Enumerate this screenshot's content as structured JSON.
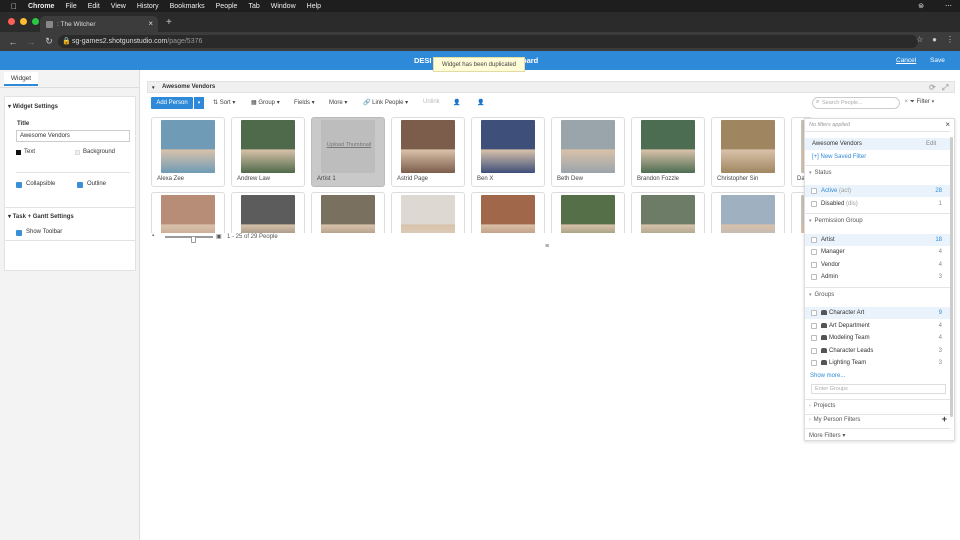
{
  "macmenu": {
    "apple": "",
    "app": "Chrome",
    "items": [
      "File",
      "Edit",
      "View",
      "History",
      "Bookmarks",
      "People",
      "Tab",
      "Window",
      "Help"
    ]
  },
  "browser": {
    "tab_title": ": The Witcher",
    "url_host": "sg-games2.shotgunstudio.com",
    "url_path": "/page/5376"
  },
  "header": {
    "title_left": "DESI",
    "title_right": "oard",
    "cancel": "Cancel",
    "save": "Save"
  },
  "toast": "Widget has been duplicated",
  "left_panel": {
    "tab": "Widget",
    "widget_settings": "Widget Settings",
    "title_label": "Title",
    "title_value": "Awesome Vendors",
    "text_label": "Text",
    "background_label": "Background",
    "collapsible": "Collapsible",
    "outline": "Outline",
    "task_gantt": "Task + Gantt Settings",
    "show_toolbar": "Show Toolbar"
  },
  "widget": {
    "title": "Awesome Vendors",
    "toolbar": {
      "add_person": "Add Person",
      "sort": "Sort",
      "group": "Group",
      "fields": "Fields",
      "more": "More",
      "link_people": "Link People",
      "unlink": "Unlink",
      "search_placeholder": "Search People...",
      "filter": "Filter"
    },
    "people_row1": [
      "Alexa Zee",
      "Andrew Law",
      "Artist 1",
      "Astrid Page",
      "Ben X",
      "Beth Dew",
      "Brandon Fozzle",
      "Christopher Sin",
      "Da"
    ],
    "upload_thumb": "Upload Thumbnail",
    "pager": "1 - 25 of 29 People"
  },
  "filter_panel": {
    "none": "No filters applied",
    "saved": "Awesome Vendors",
    "edit": "Edit",
    "new_saved": "[+] New Saved Filter",
    "status": "Status",
    "status_items": [
      {
        "label": "Active",
        "tag": "(act)",
        "count": "28"
      },
      {
        "label": "Disabled",
        "tag": "(dis)",
        "count": "1"
      }
    ],
    "permission_group": "Permission Group",
    "perm_items": [
      {
        "label": "Artist",
        "count": "18"
      },
      {
        "label": "Manager",
        "count": "4"
      },
      {
        "label": "Vendor",
        "count": "4"
      },
      {
        "label": "Admin",
        "count": "3"
      }
    ],
    "groups": "Groups",
    "group_items": [
      {
        "label": "Character Art",
        "count": "9"
      },
      {
        "label": "Art Department",
        "count": "4"
      },
      {
        "label": "Modeling Team",
        "count": "4"
      },
      {
        "label": "Character Leads",
        "count": "3"
      },
      {
        "label": "Lighting Team",
        "count": "3"
      }
    ],
    "show_more": "Show more...",
    "enter_groups": "Enter Groups",
    "projects": "Projects",
    "my_person_filters": "My Person Filters",
    "more_filters": "More Filters"
  },
  "colors": {
    "accent": "#2e8ad8",
    "photo1": [
      "#6f9bb6",
      "#4f6a4a",
      "#bdbdbd",
      "#7c5d4c",
      "#3e4f7a",
      "#9aa4ab",
      "#4d6d52",
      "#a08660",
      "#c8c3b8"
    ],
    "photo2": [
      "#b88d78",
      "#5c5c5c",
      "#7a7060",
      "#ddd8d2",
      "#a0674a",
      "#556f48",
      "#6d7c66",
      "#9fb0c0",
      "#c7c4bc"
    ]
  }
}
